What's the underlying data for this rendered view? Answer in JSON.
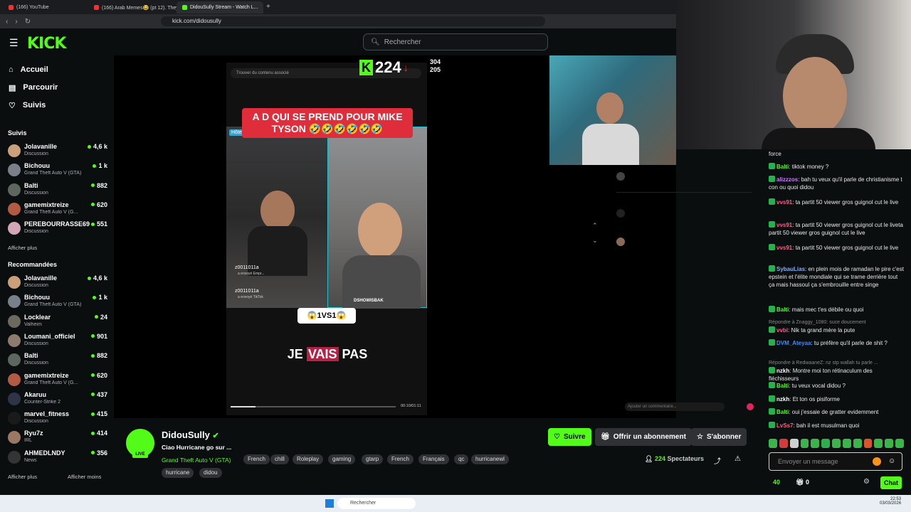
{
  "browser": {
    "tabs": [
      "(166) YouTube",
      "(166) Arab Memes😂 (pt 12). They h",
      "DidouSully Stream - Watch L..."
    ],
    "url": "kick.com/didousully"
  },
  "header": {
    "logo": "KICK",
    "search_placeholder": "Rechercher"
  },
  "sidebar": {
    "nav": [
      "Accueil",
      "Parcourir",
      "Suivis"
    ],
    "followed_title": "Suivis",
    "followed": [
      {
        "name": "Jolavanille",
        "category": "Discussion",
        "viewers": "4,6 k",
        "color": "#c9a07a"
      },
      {
        "name": "Bichouu",
        "category": "Grand Theft Auto V (GTA)",
        "viewers": "1 k",
        "color": "#7a8089"
      },
      {
        "name": "Balti",
        "category": "Discussion",
        "viewers": "882",
        "color": "#5e6660"
      },
      {
        "name": "gamemixtreize",
        "category": "Grand Theft Auto V (G...",
        "viewers": "620",
        "color": "#b25a42"
      },
      {
        "name": "PEREBOURRASSE69",
        "category": "Discussion",
        "viewers": "551",
        "color": "#d3a6b7"
      }
    ],
    "show_more": "Afficher plus",
    "recommended_title": "Recommandées",
    "recommended": [
      {
        "name": "Jolavanille",
        "category": "Discussion",
        "viewers": "4,6 k",
        "color": "#c9a07a"
      },
      {
        "name": "Bichouu",
        "category": "Grand Theft Auto V (GTA)",
        "viewers": "1 k",
        "color": "#7a8089"
      },
      {
        "name": "Locklear",
        "category": "Valheim",
        "viewers": "24",
        "color": "#6d6a5d"
      },
      {
        "name": "Loumani_officiel",
        "category": "Discussion",
        "viewers": "901",
        "color": "#8d7b6e"
      },
      {
        "name": "Balti",
        "category": "Discussion",
        "viewers": "882",
        "color": "#5e6660"
      },
      {
        "name": "gamemixtreize",
        "category": "Grand Theft Auto V (G...",
        "viewers": "620",
        "color": "#b25a42"
      },
      {
        "name": "Akaruu",
        "category": "Counter-Strike 2",
        "viewers": "437",
        "color": "#2f3546"
      },
      {
        "name": "marvel_fitness",
        "category": "Discussion",
        "viewers": "415",
        "color": "#1a1a1a"
      },
      {
        "name": "Ryu7z",
        "category": "IRL",
        "viewers": "414",
        "color": "#9a7863"
      },
      {
        "name": "AHMEDLNDY",
        "category": "News",
        "viewers": "356",
        "color": "#343434"
      }
    ],
    "show_more2": "Afficher plus",
    "show_less": "Afficher moins"
  },
  "video": {
    "tiktok_search": "Trouver du contenu associé",
    "banner": "A D QUI SE PREND POUR MIKE TYSON 🤣🤣🤣🤣🤣🤣",
    "host_tag": "Hôte",
    "gift1_user": "z0011011a",
    "gift1_text": "a envoyé Empr...",
    "gift2_user": "z0011011a",
    "gift2_text": "a envoyé TikTok",
    "watermark": "DSHOWISBAK",
    "vs_label": "😱1VS1😱",
    "subtitle_pre": "JE",
    "subtitle_hl": "VAIS",
    "subtitle_post": "PAS",
    "time": "00:10/01:11",
    "progress": 0.15,
    "overlay_count": "224",
    "overlay_n1": "304",
    "overlay_n2": "205",
    "comment_placeholder": "Ajouter un commentaire..."
  },
  "chat": {
    "messages": [
      {
        "user": "",
        "text": "force",
        "color": "#ffffff"
      },
      {
        "user": "Balti",
        "text": "tiktok money ?",
        "color": "#53fc18"
      },
      {
        "user": "alizzzos",
        "text": "bah tu veux qu'il parle de christianisme t con ou quoi didou",
        "color": "#c77dff"
      },
      {
        "user": "vvs91",
        "text": "ta partit 50 viewer gros guignol cut le live",
        "color": "#ff5c8a"
      },
      {
        "user": "vvs91",
        "text": "ta partit 50 viewer gros guignol cut le liveta partit 50 viewer gros guignol cut le live",
        "color": "#ff5c8a"
      },
      {
        "user": "vvs91",
        "text": "ta partit 50 viewer gros guignol cut le live",
        "color": "#ff5c8a"
      },
      {
        "user": "SybauLias",
        "text": "en plein mois de ramadan le pire c'est epstein et l'élite mondiale qui se trame derrière tout ça mais hassoul ça s'embrouille entre singe",
        "color": "#7fb0ff"
      },
      {
        "user": "Balti",
        "text": "mais mec t'es débile ou quoi",
        "color": "#53fc18"
      },
      {
        "user": "vvbi",
        "text": "Nik ta grand mère la pute",
        "color": "#ff5c8a",
        "reply": "Répondre à Znaggy_1080: suce doucement"
      },
      {
        "user": "DVM_Ateyaa",
        "text": "tu préfère qu'il parle de shit ?",
        "color": "#3d8bff"
      },
      {
        "user": "nzkh",
        "text": "Montre moi ton rétinaculum des fléchisseurs",
        "color": "#ffffff",
        "reply": "Répondre à RedwaaneZ: nz stp wallah tu parle ..."
      },
      {
        "user": "Balti",
        "text": "tu veux vocal didou ?",
        "color": "#53fc18"
      },
      {
        "user": "nzkh",
        "text": "Et ton os pisiforme",
        "color": "#ffffff"
      },
      {
        "user": "Balti",
        "text": "oui j'essaie de gratter evidemment",
        "color": "#53fc18"
      },
      {
        "user": "LvSs7",
        "text": "bah il est musulman quoi",
        "color": "#ff5c8a"
      }
    ],
    "input_placeholder": "Envoyer un message",
    "points": "40",
    "gifts": "0",
    "send_label": "Chat"
  },
  "stream": {
    "streamer": "DidouSully",
    "title": "Ciao Hurricane go sur ...",
    "category": "Grand Theft Auto V (GTA)",
    "tags": [
      "French",
      "chill",
      "Roleplay",
      "gaming",
      "gtarp",
      "French",
      "Français",
      "qc",
      "hurricanewl",
      "hurricane",
      "didou"
    ],
    "live_label": "LIVE",
    "follow_label": "Suivre",
    "gift_label": "Offrir un abonnement",
    "subscribe_label": "S'abonner",
    "viewers": "224",
    "viewers_label": "Spectateurs"
  },
  "taskbar": {
    "search": "Rechercher",
    "time": "22:53",
    "date": "03/03/2026"
  }
}
